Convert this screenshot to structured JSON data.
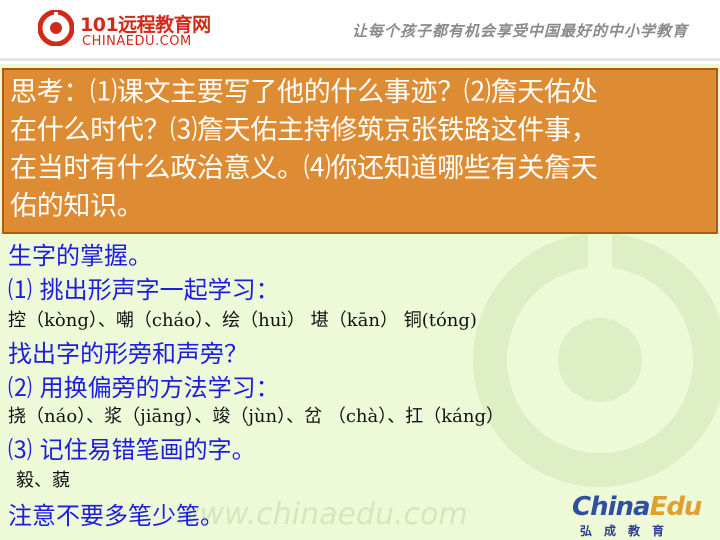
{
  "header": {
    "logo_cn": "101远程教育网",
    "logo_en": "CHINAEDU.COM",
    "slogan": "让每个孩子都有机会享受中国最好的中小学教育"
  },
  "question": {
    "text": "思考：⑴课文主要写了他的什么事迹？⑵詹天佑处\n在什么时代？⑶詹天佑主持修筑京张铁路这件事，\n在当时有什么政治意义。⑷你还知道哪些有关詹天\n佑的知识。"
  },
  "lesson": {
    "line1": "生字的掌握。",
    "line2": "⑴   挑出形声字一起学习：",
    "line3": "控（kòng）、嘲（cháo）、绘（huì） 堪（kān） 铜(tóng)",
    "line4": "找出字的形旁和声旁？",
    "line5": "⑵   用换偏旁的方法学习：",
    "line6": "挠（náo）、浆（jiāng）、竣（jùn）、岔 （chà）、扛（káng）",
    "line7": "⑶   记住易错笔画的字。",
    "line8": "毅、藐",
    "line9": "注意不要多笔少笔。"
  },
  "brand": {
    "name_part1": "China",
    "name_part2": "Edu",
    "sub": "弘成教育"
  },
  "watermark_text": "www.chinaedu.com"
}
